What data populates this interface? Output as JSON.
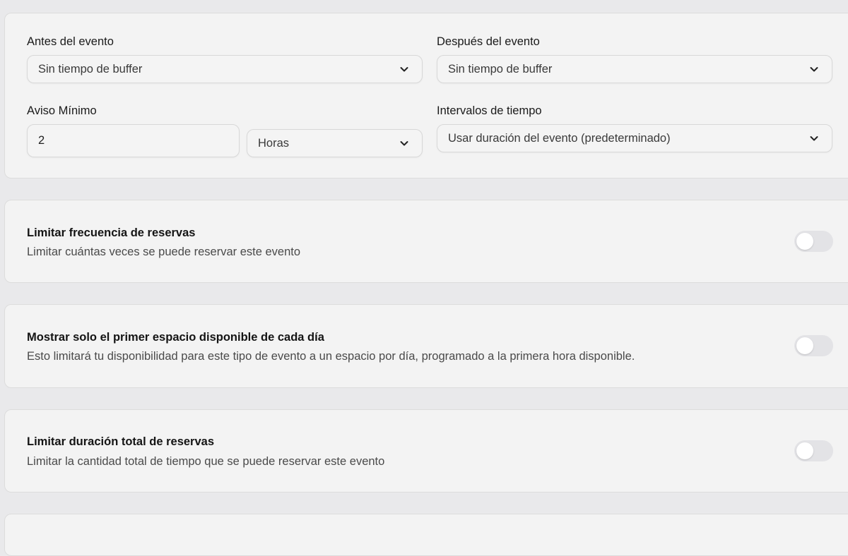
{
  "buffer": {
    "before": {
      "label": "Antes del evento",
      "value": "Sin tiempo de buffer"
    },
    "after": {
      "label": "Después del evento",
      "value": "Sin tiempo de buffer"
    }
  },
  "notice": {
    "label": "Aviso Mínimo",
    "amount": "2",
    "unit": "Horas"
  },
  "intervals": {
    "label": "Intervalos de tiempo",
    "value": "Usar duración del evento (predeterminado)"
  },
  "settings": [
    {
      "title": "Limitar frecuencia de reservas",
      "description": "Limitar cuántas veces se puede reservar este evento",
      "enabled": false
    },
    {
      "title": "Mostrar solo el primer espacio disponible de cada día",
      "description": "Esto limitará tu disponibilidad para este tipo de evento a un espacio por día, programado a la primera hora disponible.",
      "enabled": false
    },
    {
      "title": "Limitar duración total de reservas",
      "description": "Limitar la cantidad total de tiempo que se puede reservar este evento",
      "enabled": false
    }
  ],
  "colors": {
    "background": "#e9e9eb",
    "card": "#f3f3f3",
    "toggle_off": "#e3e3e6"
  }
}
